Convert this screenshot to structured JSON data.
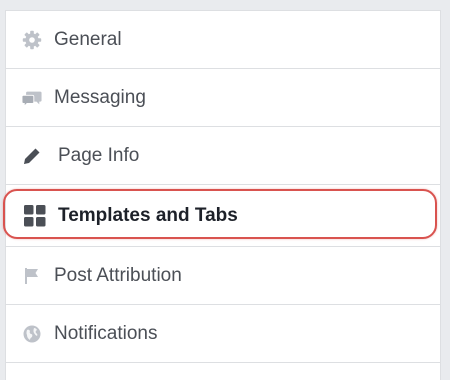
{
  "settings_menu": {
    "items": [
      {
        "label": "General",
        "icon": "gear-icon"
      },
      {
        "label": "Messaging",
        "icon": "speech-bubbles-icon"
      },
      {
        "label": "Page Info",
        "icon": "pencil-icon"
      },
      {
        "label": "Templates and Tabs",
        "icon": "grid-icon",
        "selected": true
      },
      {
        "label": "Post Attribution",
        "icon": "flag-icon"
      },
      {
        "label": "Notifications",
        "icon": "globe-icon"
      }
    ]
  },
  "colors": {
    "icon": "#bec2c9",
    "icon_selected": "#4b4f56",
    "label": "#4b4f56",
    "label_selected": "#1d2129",
    "highlight": "#d9534f",
    "divider": "#dddfe2",
    "background": "#e9ebee"
  }
}
